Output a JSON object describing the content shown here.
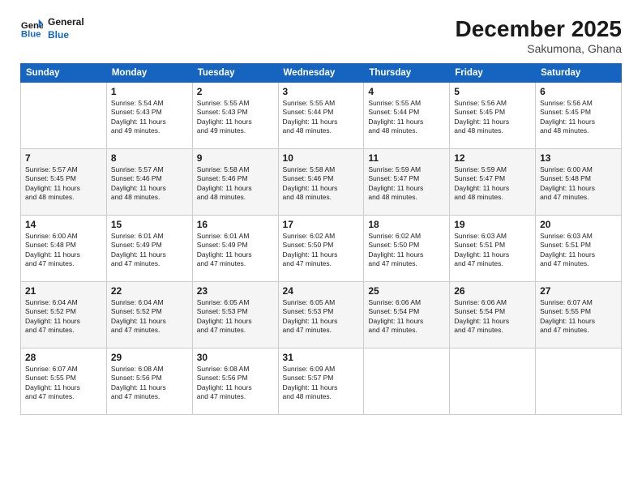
{
  "logo": {
    "line1": "General",
    "line2": "Blue"
  },
  "title": "December 2025",
  "location": "Sakumona, Ghana",
  "days": [
    "Sunday",
    "Monday",
    "Tuesday",
    "Wednesday",
    "Thursday",
    "Friday",
    "Saturday"
  ],
  "weeks": [
    [
      {
        "date": "",
        "text": ""
      },
      {
        "date": "1",
        "text": "Sunrise: 5:54 AM\nSunset: 5:43 PM\nDaylight: 11 hours\nand 49 minutes."
      },
      {
        "date": "2",
        "text": "Sunrise: 5:55 AM\nSunset: 5:43 PM\nDaylight: 11 hours\nand 49 minutes."
      },
      {
        "date": "3",
        "text": "Sunrise: 5:55 AM\nSunset: 5:44 PM\nDaylight: 11 hours\nand 48 minutes."
      },
      {
        "date": "4",
        "text": "Sunrise: 5:55 AM\nSunset: 5:44 PM\nDaylight: 11 hours\nand 48 minutes."
      },
      {
        "date": "5",
        "text": "Sunrise: 5:56 AM\nSunset: 5:45 PM\nDaylight: 11 hours\nand 48 minutes."
      },
      {
        "date": "6",
        "text": "Sunrise: 5:56 AM\nSunset: 5:45 PM\nDaylight: 11 hours\nand 48 minutes."
      }
    ],
    [
      {
        "date": "7",
        "text": "Sunrise: 5:57 AM\nSunset: 5:45 PM\nDaylight: 11 hours\nand 48 minutes."
      },
      {
        "date": "8",
        "text": "Sunrise: 5:57 AM\nSunset: 5:46 PM\nDaylight: 11 hours\nand 48 minutes."
      },
      {
        "date": "9",
        "text": "Sunrise: 5:58 AM\nSunset: 5:46 PM\nDaylight: 11 hours\nand 48 minutes."
      },
      {
        "date": "10",
        "text": "Sunrise: 5:58 AM\nSunset: 5:46 PM\nDaylight: 11 hours\nand 48 minutes."
      },
      {
        "date": "11",
        "text": "Sunrise: 5:59 AM\nSunset: 5:47 PM\nDaylight: 11 hours\nand 48 minutes."
      },
      {
        "date": "12",
        "text": "Sunrise: 5:59 AM\nSunset: 5:47 PM\nDaylight: 11 hours\nand 48 minutes."
      },
      {
        "date": "13",
        "text": "Sunrise: 6:00 AM\nSunset: 5:48 PM\nDaylight: 11 hours\nand 47 minutes."
      }
    ],
    [
      {
        "date": "14",
        "text": "Sunrise: 6:00 AM\nSunset: 5:48 PM\nDaylight: 11 hours\nand 47 minutes."
      },
      {
        "date": "15",
        "text": "Sunrise: 6:01 AM\nSunset: 5:49 PM\nDaylight: 11 hours\nand 47 minutes."
      },
      {
        "date": "16",
        "text": "Sunrise: 6:01 AM\nSunset: 5:49 PM\nDaylight: 11 hours\nand 47 minutes."
      },
      {
        "date": "17",
        "text": "Sunrise: 6:02 AM\nSunset: 5:50 PM\nDaylight: 11 hours\nand 47 minutes."
      },
      {
        "date": "18",
        "text": "Sunrise: 6:02 AM\nSunset: 5:50 PM\nDaylight: 11 hours\nand 47 minutes."
      },
      {
        "date": "19",
        "text": "Sunrise: 6:03 AM\nSunset: 5:51 PM\nDaylight: 11 hours\nand 47 minutes."
      },
      {
        "date": "20",
        "text": "Sunrise: 6:03 AM\nSunset: 5:51 PM\nDaylight: 11 hours\nand 47 minutes."
      }
    ],
    [
      {
        "date": "21",
        "text": "Sunrise: 6:04 AM\nSunset: 5:52 PM\nDaylight: 11 hours\nand 47 minutes."
      },
      {
        "date": "22",
        "text": "Sunrise: 6:04 AM\nSunset: 5:52 PM\nDaylight: 11 hours\nand 47 minutes."
      },
      {
        "date": "23",
        "text": "Sunrise: 6:05 AM\nSunset: 5:53 PM\nDaylight: 11 hours\nand 47 minutes."
      },
      {
        "date": "24",
        "text": "Sunrise: 6:05 AM\nSunset: 5:53 PM\nDaylight: 11 hours\nand 47 minutes."
      },
      {
        "date": "25",
        "text": "Sunrise: 6:06 AM\nSunset: 5:54 PM\nDaylight: 11 hours\nand 47 minutes."
      },
      {
        "date": "26",
        "text": "Sunrise: 6:06 AM\nSunset: 5:54 PM\nDaylight: 11 hours\nand 47 minutes."
      },
      {
        "date": "27",
        "text": "Sunrise: 6:07 AM\nSunset: 5:55 PM\nDaylight: 11 hours\nand 47 minutes."
      }
    ],
    [
      {
        "date": "28",
        "text": "Sunrise: 6:07 AM\nSunset: 5:55 PM\nDaylight: 11 hours\nand 47 minutes."
      },
      {
        "date": "29",
        "text": "Sunrise: 6:08 AM\nSunset: 5:56 PM\nDaylight: 11 hours\nand 47 minutes."
      },
      {
        "date": "30",
        "text": "Sunrise: 6:08 AM\nSunset: 5:56 PM\nDaylight: 11 hours\nand 47 minutes."
      },
      {
        "date": "31",
        "text": "Sunrise: 6:09 AM\nSunset: 5:57 PM\nDaylight: 11 hours\nand 48 minutes."
      },
      {
        "date": "",
        "text": ""
      },
      {
        "date": "",
        "text": ""
      },
      {
        "date": "",
        "text": ""
      }
    ]
  ]
}
